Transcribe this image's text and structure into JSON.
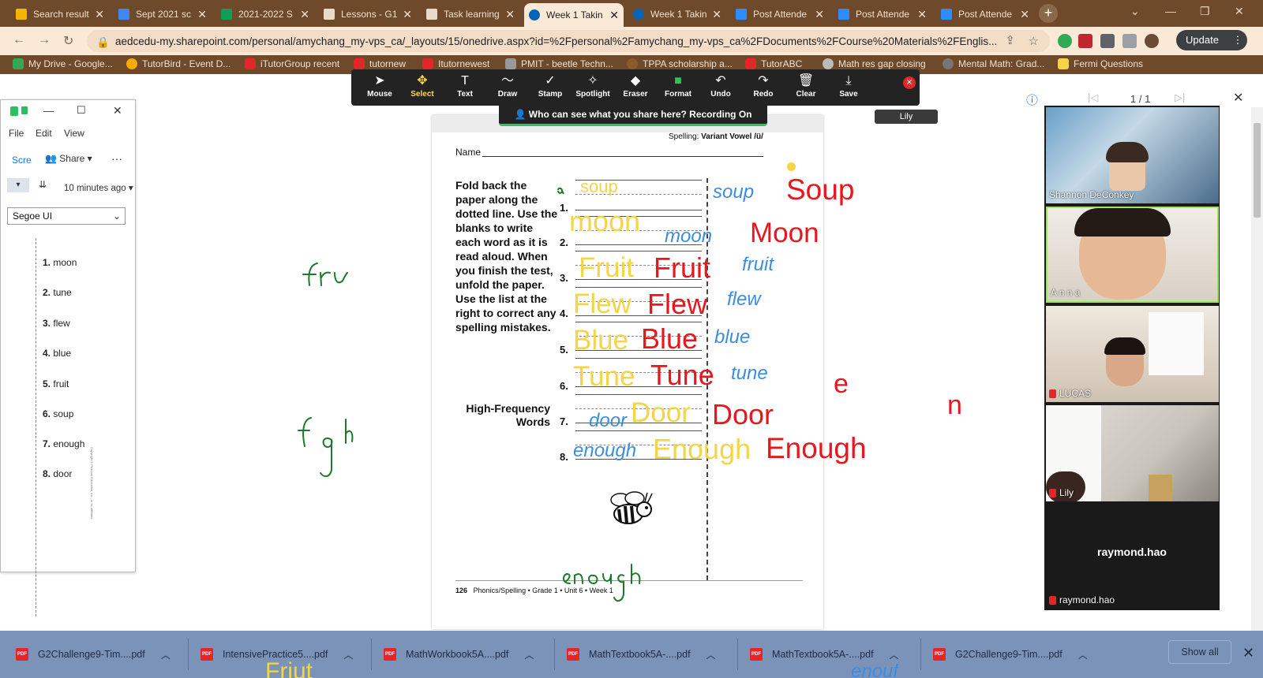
{
  "tabs": [
    {
      "title": "Search result",
      "color": "#4285f4"
    },
    {
      "title": "Sept 2021 sc",
      "color": "#4285f4"
    },
    {
      "title": "2021-2022 S",
      "color": "#0f9d58"
    },
    {
      "title": "Lessons - G1",
      "color": "#e8dcc8"
    },
    {
      "title": "Task learning",
      "color": "#e8dcc8"
    },
    {
      "title": "Week 1 Takin",
      "color": "#0364b8"
    },
    {
      "title": "Week 1 Takin",
      "color": "#0364b8"
    },
    {
      "title": "Post Attende",
      "color": "#2d8cff"
    },
    {
      "title": "Post Attende",
      "color": "#2d8cff"
    },
    {
      "title": "Post Attende",
      "color": "#2d8cff"
    }
  ],
  "address": {
    "url": "aedcedu-my.sharepoint.com/personal/amychang_my-vps_ca/_layouts/15/onedrive.aspx?id=%2Fpersonal%2Famychang_my-vps_ca%2FDocuments%2FCourse%20Materials%2FEnglis...",
    "update_label": "Update"
  },
  "bookmarks": [
    {
      "label": "My Drive - Google...",
      "color": "#34a853"
    },
    {
      "label": "TutorBird - Event D...",
      "color": "#f9ab00"
    },
    {
      "label": "iTutorGroup recent",
      "color": "#e02828"
    },
    {
      "label": "tutornew",
      "color": "#e02828"
    },
    {
      "label": "Itutornewest",
      "color": "#e02828"
    },
    {
      "label": "PMIT - beetle Techn...",
      "color": "#999999"
    },
    {
      "label": "TPPA scholarship a...",
      "color": "#8a5a2a"
    },
    {
      "label": "TutorABC",
      "color": "#e02828"
    },
    {
      "label": "Math res gap closing",
      "color": "#bbbbbb"
    },
    {
      "label": "Mental Math: Grad...",
      "color": "#777777"
    },
    {
      "label": "Fermi Questions",
      "color": "#f4d44a"
    }
  ],
  "zoom_toolbar": {
    "tools": [
      {
        "label": "Mouse",
        "icon": "mouse-pointer-icon",
        "glyph": "➤"
      },
      {
        "label": "Select",
        "icon": "select-move-icon",
        "glyph": "✥"
      },
      {
        "label": "Text",
        "icon": "text-icon",
        "glyph": "T"
      },
      {
        "label": "Draw",
        "icon": "draw-icon",
        "glyph": "〜"
      },
      {
        "label": "Stamp",
        "icon": "stamp-check-icon",
        "glyph": "✓"
      },
      {
        "label": "Spotlight",
        "icon": "spotlight-wand-icon",
        "glyph": "✧"
      },
      {
        "label": "Eraser",
        "icon": "eraser-icon",
        "glyph": "◆"
      },
      {
        "label": "Format",
        "icon": "format-color-icon",
        "glyph": "■"
      },
      {
        "label": "Undo",
        "icon": "undo-icon",
        "glyph": "↶"
      },
      {
        "label": "Redo",
        "icon": "redo-icon",
        "glyph": "↷"
      },
      {
        "label": "Clear",
        "icon": "trash-icon",
        "glyph": "🗑"
      },
      {
        "label": "Save",
        "icon": "save-download-icon",
        "glyph": "⤓"
      }
    ],
    "selected_tool": "Select",
    "share_notice": "Who can see what you share here? Recording On",
    "presenter_tag": "Lily"
  },
  "pdf_viewer": {
    "page_indicator": "1 / 1"
  },
  "notepad": {
    "menu": [
      "File",
      "Edit",
      "View"
    ],
    "scre_label": "Scre",
    "share_label": "Share",
    "more": "···",
    "last_saved": "10 minutes ago",
    "font": "Segoe UI",
    "list": [
      {
        "n": "1.",
        "w": "moon"
      },
      {
        "n": "2.",
        "w": "tune"
      },
      {
        "n": "3.",
        "w": "flew"
      },
      {
        "n": "4.",
        "w": "blue"
      },
      {
        "n": "5.",
        "w": "fruit"
      },
      {
        "n": "6.",
        "w": "soup"
      },
      {
        "n": "7.",
        "w": "enough"
      },
      {
        "n": "8.",
        "w": "door"
      }
    ],
    "copyright": "Copyright © Pearson Education, Inc., or its affiliates."
  },
  "worksheet": {
    "spelling_prefix": "Spelling:",
    "spelling_title": "Variant Vowel /ü/",
    "name_label": "Name",
    "instructions": "Fold back the paper along the dotted line. Use the blanks to write each word as it is read aloud. When you finish the test, unfold the paper. Use the list at the right to correct any spelling mistakes.",
    "hfw_label": "High-Frequency Words",
    "numbers": [
      "1.",
      "2.",
      "3.",
      "4.",
      "5.",
      "6.",
      "7.",
      "8."
    ],
    "footer_page": "126",
    "footer_text": "Phonics/Spelling • Grade 1 • Unit 6 • Week 1"
  },
  "annotations": {
    "yellow": [
      "soup",
      "moon",
      "Fruit",
      "Flew",
      "Blue",
      "Tune",
      "Door",
      "Enough"
    ],
    "red": [
      "Soup",
      "Moon",
      "Fruit",
      "Flew",
      "Blue",
      "Tune",
      "Door",
      "Enough",
      "e",
      "n"
    ],
    "blue": [
      "soup",
      "moon",
      "fruit",
      "flew",
      "blue",
      "tune",
      "door",
      "enough"
    ],
    "handwritten": [
      "fru",
      "fgh",
      "enough"
    ],
    "below_page": {
      "yellow": "Friut",
      "blue": "enouf"
    }
  },
  "participants": [
    {
      "name": "Shannon DeConkey",
      "muted": false
    },
    {
      "name": "A n n a",
      "muted": false
    },
    {
      "name": "LUCAS",
      "muted": true
    },
    {
      "name": "Lily",
      "muted": true
    },
    {
      "name": "raymond.hao",
      "muted": true,
      "display_name": "raymond.hao"
    }
  ],
  "downloads": {
    "items": [
      "G2Challenge9-Tim....pdf",
      "IntensivePractice5....pdf",
      "MathWorkbook5A....pdf",
      "MathTextbook5A-....pdf",
      "MathTextbook5A-....pdf",
      "G2Challenge9-Tim....pdf"
    ],
    "show_all": "Show all"
  },
  "colors": {
    "browser_frame": "#6e4a2a",
    "toolbar_bg": "#fbe9d8",
    "annot_yellow": "#f4d44a",
    "annot_red": "#e8171f",
    "annot_blue": "#3b8de0",
    "pen_green": "#1c7a2c",
    "downloads_bar": "#7c93b9"
  }
}
